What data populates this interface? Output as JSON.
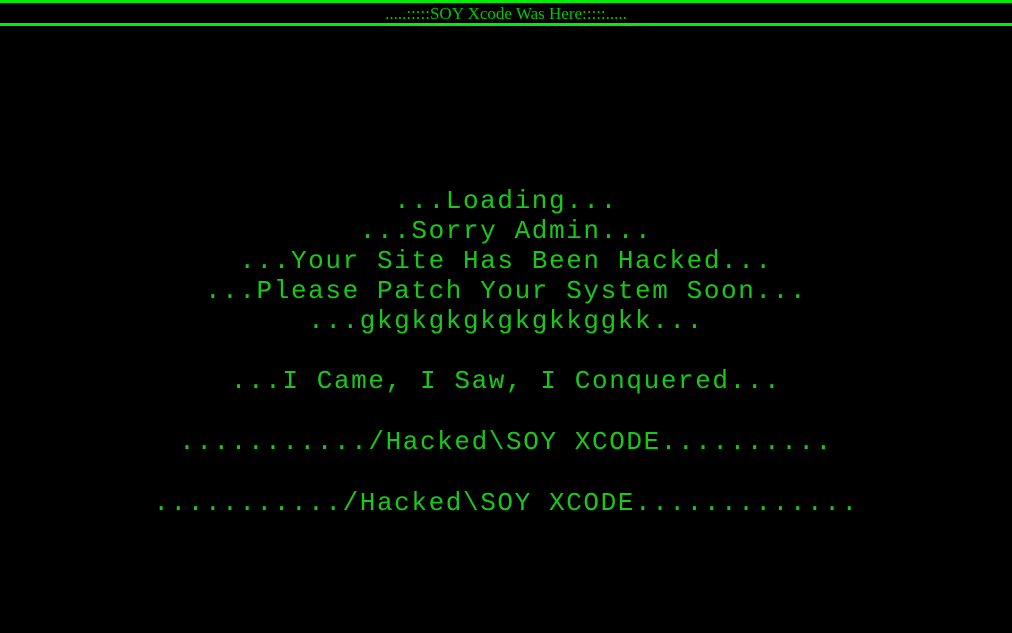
{
  "page": {
    "background_color": "#000000",
    "text_color": "#19c819",
    "rule_color": "#00ee00"
  },
  "header": {
    "banner_text": ".....:::::SOY Xcode Was Here:::::....."
  },
  "main": {
    "lines": [
      {
        "text": "...Loading...",
        "gap": "none"
      },
      {
        "text": "...Sorry Admin...",
        "gap": "none"
      },
      {
        "text": "...Your Site Has Been Hacked...",
        "gap": "none"
      },
      {
        "text": "...Please Patch Your System Soon...",
        "gap": "none"
      },
      {
        "text": "...gkgkgkgkgkgkkggkk...",
        "gap": "none"
      },
      {
        "text": "...I Came, I Saw, I Conquered...",
        "gap": "blank"
      },
      {
        "text": ".........../Hacked\\SOY XCODE..........",
        "gap": "blank"
      },
      {
        "text": ".........../Hacked\\SOY XCODE.............",
        "gap": "blank"
      }
    ]
  }
}
